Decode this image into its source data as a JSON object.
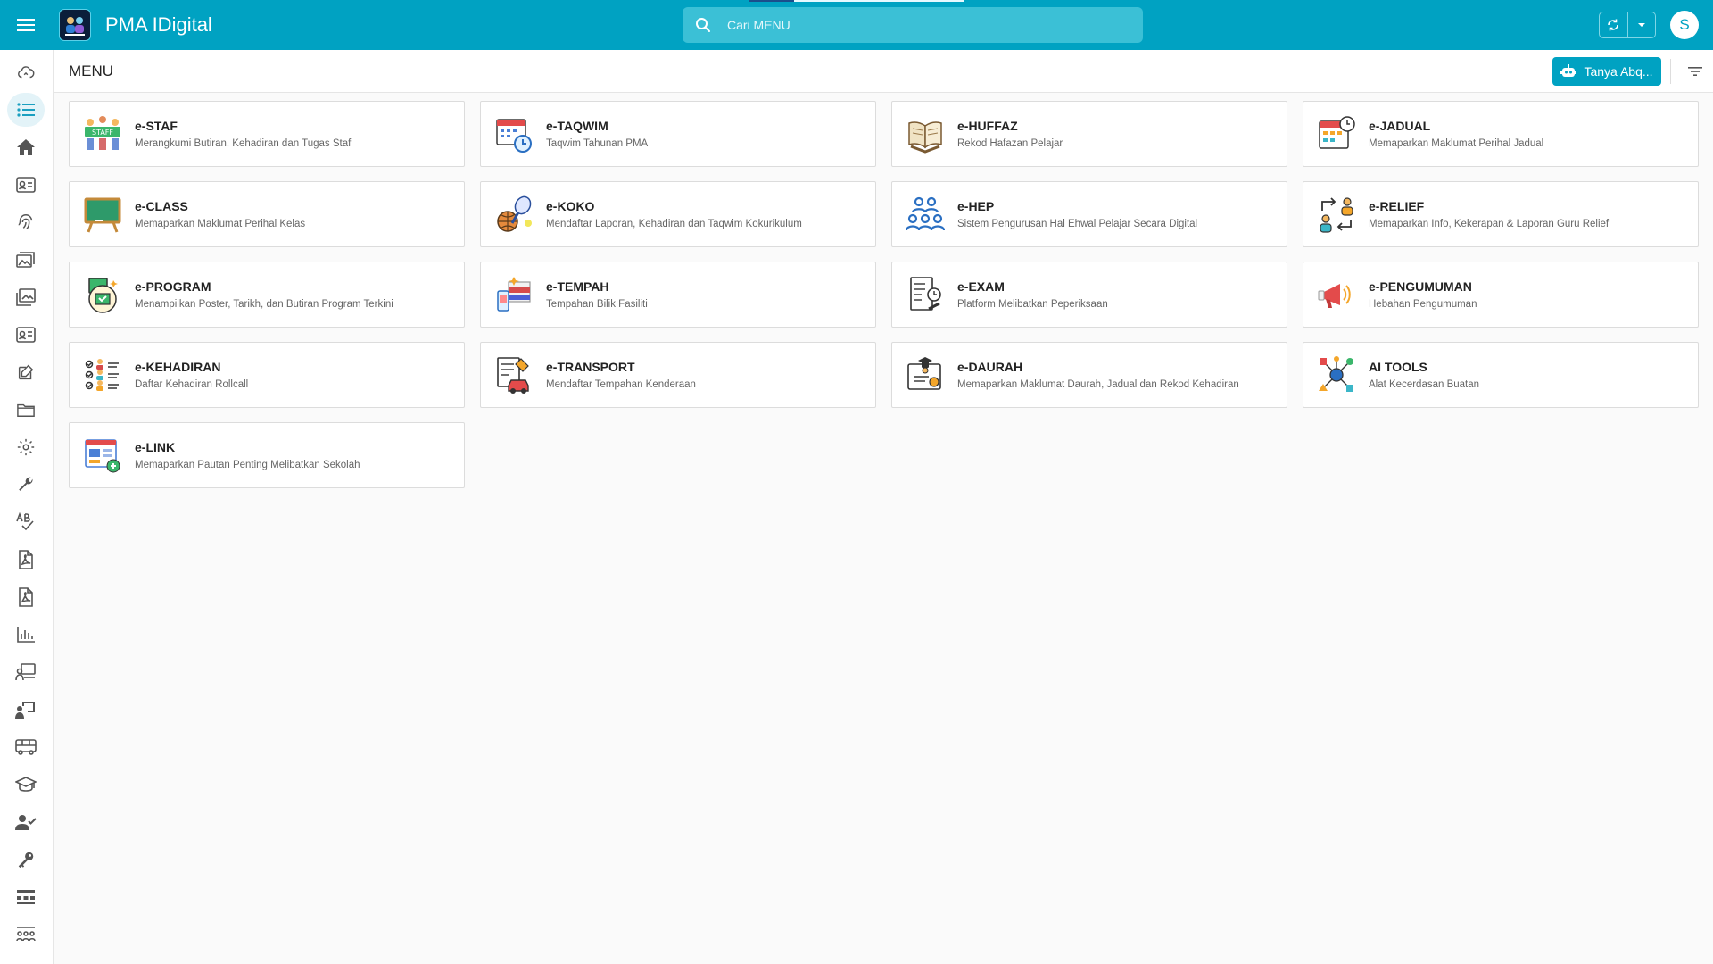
{
  "app": {
    "title": "PMA IDigital",
    "user_initial": "S"
  },
  "search": {
    "placeholder": "Cari MENU"
  },
  "colors": {
    "primary": "#00a2c2",
    "background": "#fafafa"
  },
  "page": {
    "title": "MENU",
    "ask_button": "Tanya Abq..."
  },
  "sidebar": {
    "items": [
      {
        "icon": "cloud-sync-icon"
      },
      {
        "icon": "list-icon",
        "active": true
      },
      {
        "icon": "home-icon"
      },
      {
        "icon": "id-card-icon"
      },
      {
        "icon": "fingerprint-icon"
      },
      {
        "icon": "photo-stack-icon"
      },
      {
        "icon": "image-gallery-icon"
      },
      {
        "icon": "contact-card-icon"
      },
      {
        "icon": "edit-note-icon"
      },
      {
        "icon": "folder-icon"
      },
      {
        "icon": "gear-icon"
      },
      {
        "icon": "wrench-icon"
      },
      {
        "icon": "spellcheck-icon"
      },
      {
        "icon": "pdf-file-icon"
      },
      {
        "icon": "pdf-document-icon"
      },
      {
        "icon": "bar-chart-icon"
      },
      {
        "icon": "teacher-board-icon"
      },
      {
        "icon": "presenter-icon"
      },
      {
        "icon": "bus-icon"
      },
      {
        "icon": "graduation-cap-icon"
      },
      {
        "icon": "user-check-icon"
      },
      {
        "icon": "key-icon"
      },
      {
        "icon": "org-chart-icon"
      },
      {
        "icon": "group-icon"
      }
    ]
  },
  "menu": [
    {
      "name": "e-STAF",
      "desc": "Merangkumi Butiran, Kehadiran dan Tugas Staf",
      "icon": "staff-icon"
    },
    {
      "name": "e-TAQWIM",
      "desc": "Taqwim Tahunan PMA",
      "icon": "calendar-clock-icon"
    },
    {
      "name": "e-HUFFAZ",
      "desc": "Rekod Hafazan Pelajar",
      "icon": "quran-icon"
    },
    {
      "name": "e-JADUAL",
      "desc": "Memaparkan Maklumat Perihal Jadual",
      "icon": "schedule-icon"
    },
    {
      "name": "e-CLASS",
      "desc": "Memaparkan Maklumat Perihal Kelas",
      "icon": "chalkboard-icon"
    },
    {
      "name": "e-KOKO",
      "desc": "Mendaftar Laporan, Kehadiran dan Taqwim Kokurikulum",
      "icon": "sports-icon"
    },
    {
      "name": "e-HEP",
      "desc": "Sistem Pengurusan Hal Ehwal Pelajar Secara Digital",
      "icon": "students-group-icon"
    },
    {
      "name": "e-RELIEF",
      "desc": "Memaparkan Info, Kekerapan & Laporan Guru Relief",
      "icon": "swap-users-icon"
    },
    {
      "name": "e-PROGRAM",
      "desc": "Menampilkan Poster, Tarikh, dan Butiran Program Terkini",
      "icon": "program-icon"
    },
    {
      "name": "e-TEMPAH",
      "desc": "Tempahan Bilik Fasiliti",
      "icon": "booking-icon"
    },
    {
      "name": "e-EXAM",
      "desc": "Platform Melibatkan Peperiksaan",
      "icon": "exam-icon"
    },
    {
      "name": "e-PENGUMUMAN",
      "desc": "Hebahan Pengumuman",
      "icon": "megaphone-icon"
    },
    {
      "name": "e-KEHADIRAN",
      "desc": "Daftar Kehadiran Rollcall",
      "icon": "attendance-icon"
    },
    {
      "name": "e-TRANSPORT",
      "desc": "Mendaftar Tempahan Kenderaan",
      "icon": "transport-icon"
    },
    {
      "name": "e-DAURAH",
      "desc": "Memaparkan Maklumat Daurah, Jadual dan Rekod Kehadiran",
      "icon": "certificate-icon"
    },
    {
      "name": "AI TOOLS",
      "desc": "Alat Kecerdasan Buatan",
      "icon": "ai-network-icon"
    },
    {
      "name": "e-LINK",
      "desc": "Memaparkan Pautan Penting Melibatkan Sekolah",
      "icon": "web-link-icon"
    }
  ]
}
